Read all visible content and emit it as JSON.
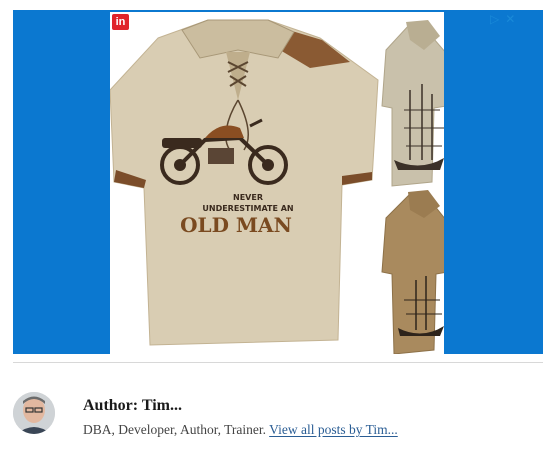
{
  "ad": {
    "logo_text": "in",
    "play_icon": "play-triangle-icon",
    "close_icon": "close-x-icon",
    "shirt_main_text_line1": "NEVER",
    "shirt_main_text_line2": "UNDERESTIMATE AN",
    "shirt_main_text_line3": "OLD MAN",
    "frame_color": "#0b78d0"
  },
  "author": {
    "title": "Author: Tim...",
    "bio": "DBA, Developer, Author, Trainer.",
    "link_text": "View all posts by Tim...",
    "link_color": "#2a5d94"
  }
}
